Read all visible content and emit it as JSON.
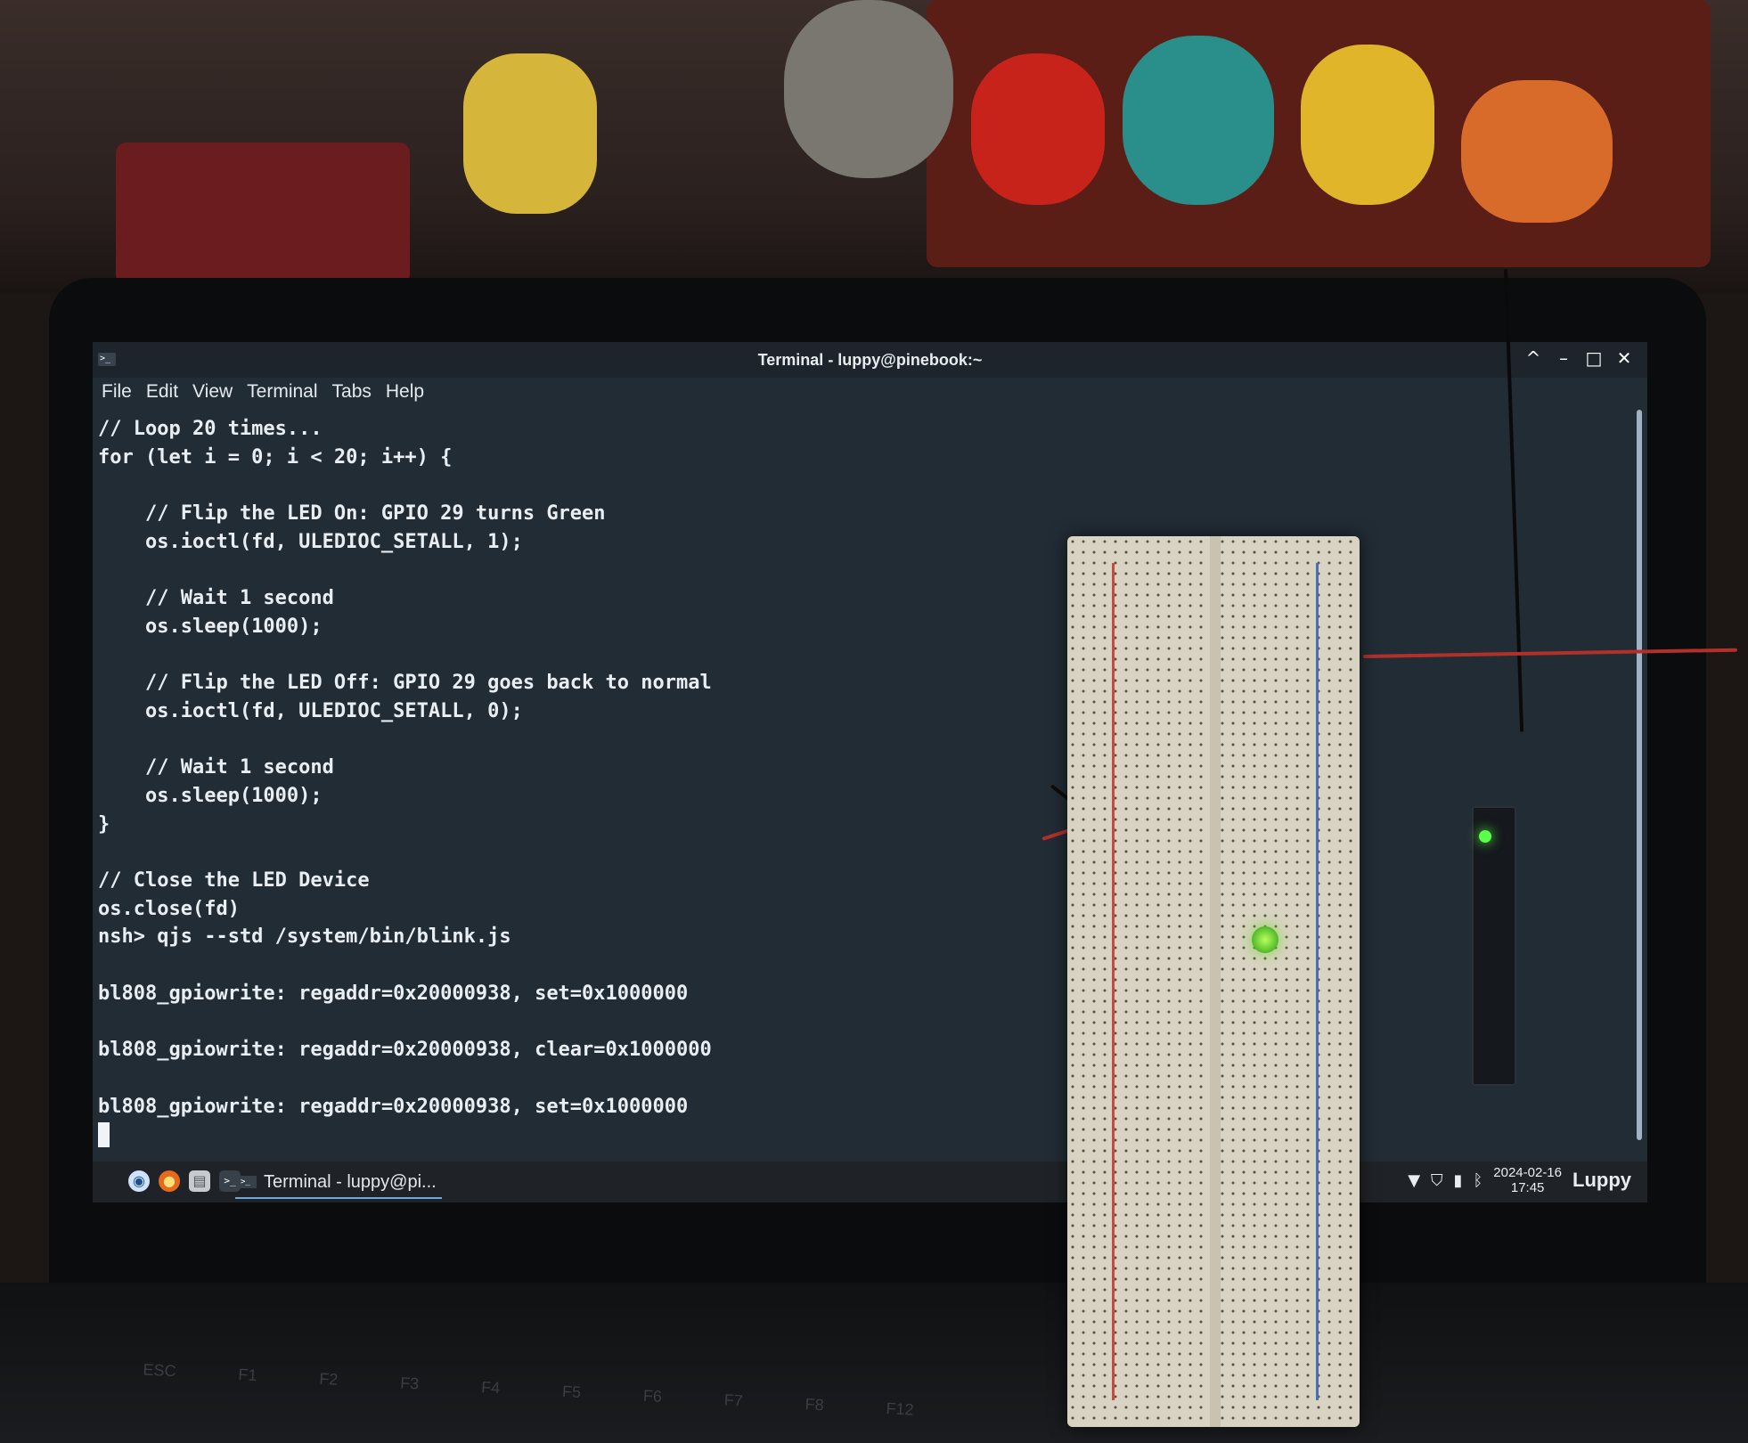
{
  "window": {
    "title": "Terminal - luppy@pinebook:~",
    "controls": [
      "^",
      "–",
      "□",
      "✕"
    ]
  },
  "menubar": {
    "items": [
      "File",
      "Edit",
      "View",
      "Terminal",
      "Tabs",
      "Help"
    ]
  },
  "terminal": {
    "lines": [
      "// Loop 20 times...",
      "for (let i = 0; i < 20; i++) {",
      "",
      "    // Flip the LED On: GPIO 29 turns Green",
      "    os.ioctl(fd, ULEDIOC_SETALL, 1);",
      "",
      "    // Wait 1 second",
      "    os.sleep(1000);",
      "",
      "    // Flip the LED Off: GPIO 29 goes back to normal",
      "    os.ioctl(fd, ULEDIOC_SETALL, 0);",
      "",
      "    // Wait 1 second",
      "    os.sleep(1000);",
      "}",
      "",
      "// Close the LED Device",
      "os.close(fd)",
      "nsh> qjs --std /system/bin/blink.js",
      "",
      "bl808_gpiowrite: regaddr=0x20000938, set=0x1000000",
      "",
      "bl808_gpiowrite: regaddr=0x20000938, clear=0x1000000",
      "",
      "bl808_gpiowrite: regaddr=0x20000938, set=0x1000000"
    ]
  },
  "taskbar": {
    "launcher_icons": [
      "whisker-menu-icon",
      "firefox-icon",
      "file-manager-icon",
      "terminal-icon"
    ],
    "task_label": "Terminal - luppy@pi...",
    "date": "2024-02-16",
    "time": "17:45",
    "user": "Luppy"
  },
  "keyboard": {
    "keys": [
      "ESC",
      "F1",
      "F2",
      "F3",
      "F4",
      "F5",
      "F6",
      "F7",
      "F8",
      "F12"
    ]
  },
  "colors": {
    "terminal_bg": "#222c35",
    "terminal_fg": "#e9eef2",
    "breadboard": "#d9d3c3",
    "led_green": "#7ddc3c"
  }
}
